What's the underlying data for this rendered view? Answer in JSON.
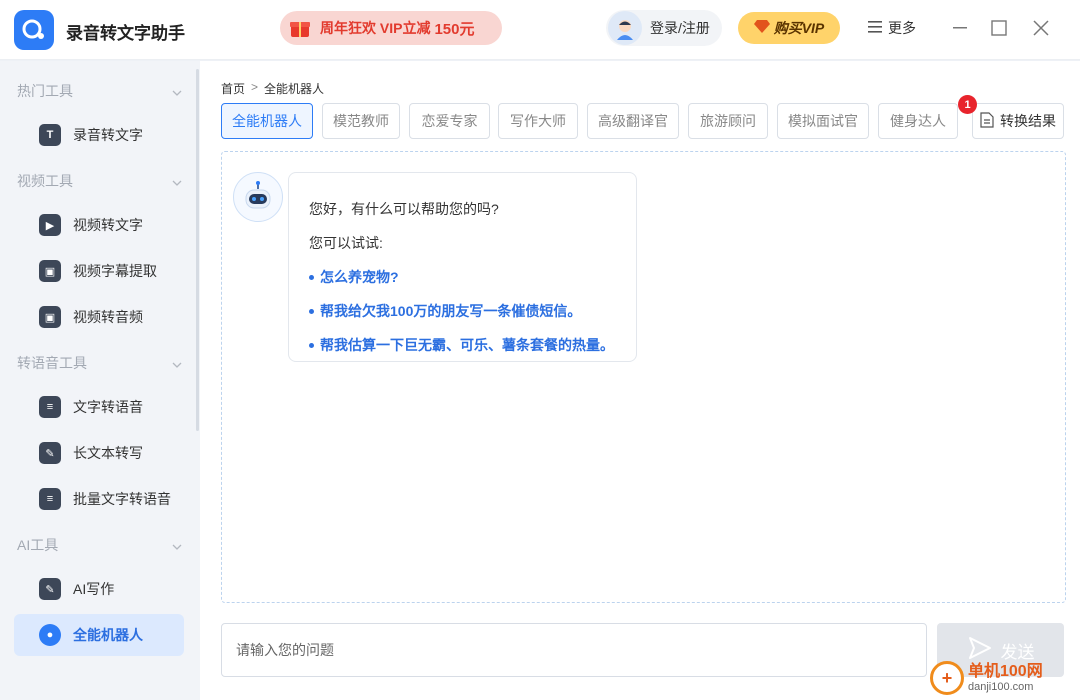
{
  "app": {
    "title": "录音转文字助手",
    "promo_text": "周年狂欢 VIP立减",
    "promo_amount": "150元",
    "login_label": "登录/注册",
    "vip_label": "购买VIP",
    "more_label": "更多"
  },
  "sidebar": {
    "sections": [
      {
        "label": "热门工具",
        "items": [
          {
            "label": "录音转文字",
            "icon": "T"
          }
        ]
      },
      {
        "label": "视频工具",
        "items": [
          {
            "label": "视频转文字",
            "icon": "▶"
          },
          {
            "label": "视频字幕提取",
            "icon": "▣"
          },
          {
            "label": "视频转音频",
            "icon": "▣"
          }
        ]
      },
      {
        "label": "转语音工具",
        "items": [
          {
            "label": "文字转语音",
            "icon": "≡"
          },
          {
            "label": "长文本转写",
            "icon": "✎"
          },
          {
            "label": "批量文字转语音",
            "icon": "≡"
          }
        ]
      },
      {
        "label": "AI工具",
        "items": [
          {
            "label": "AI写作",
            "icon": "✎"
          },
          {
            "label": "全能机器人",
            "icon": "●"
          }
        ]
      }
    ],
    "active_item": "全能机器人"
  },
  "breadcrumb": {
    "home": "首页",
    "separator": ">",
    "current": "全能机器人"
  },
  "tabs": [
    "全能机器人",
    "模范教师",
    "恋爱专家",
    "写作大师",
    "高级翻译官",
    "旅游顾问",
    "模拟面试官",
    "健身达人"
  ],
  "active_tab": "全能机器人",
  "convert_button": {
    "label": "转换结果",
    "badge": "1"
  },
  "chat": {
    "greeting": "您好，有什么可以帮助您的吗?",
    "try_label": "您可以试试:",
    "suggestions": [
      "怎么养宠物?",
      "帮我给欠我100万的朋友写一条催债短信。",
      "帮我估算一下巨无霸、可乐、薯条套餐的热量。"
    ]
  },
  "input": {
    "placeholder": "请输入您的问题",
    "value": ""
  },
  "send_label": "发送",
  "watermark": {
    "name": "单机100网",
    "url": "danji100.com"
  },
  "colors": {
    "accent": "#2d7cf6",
    "promo": "#e23b2e",
    "vip": "#ffd36a",
    "badge": "#e8242c"
  }
}
